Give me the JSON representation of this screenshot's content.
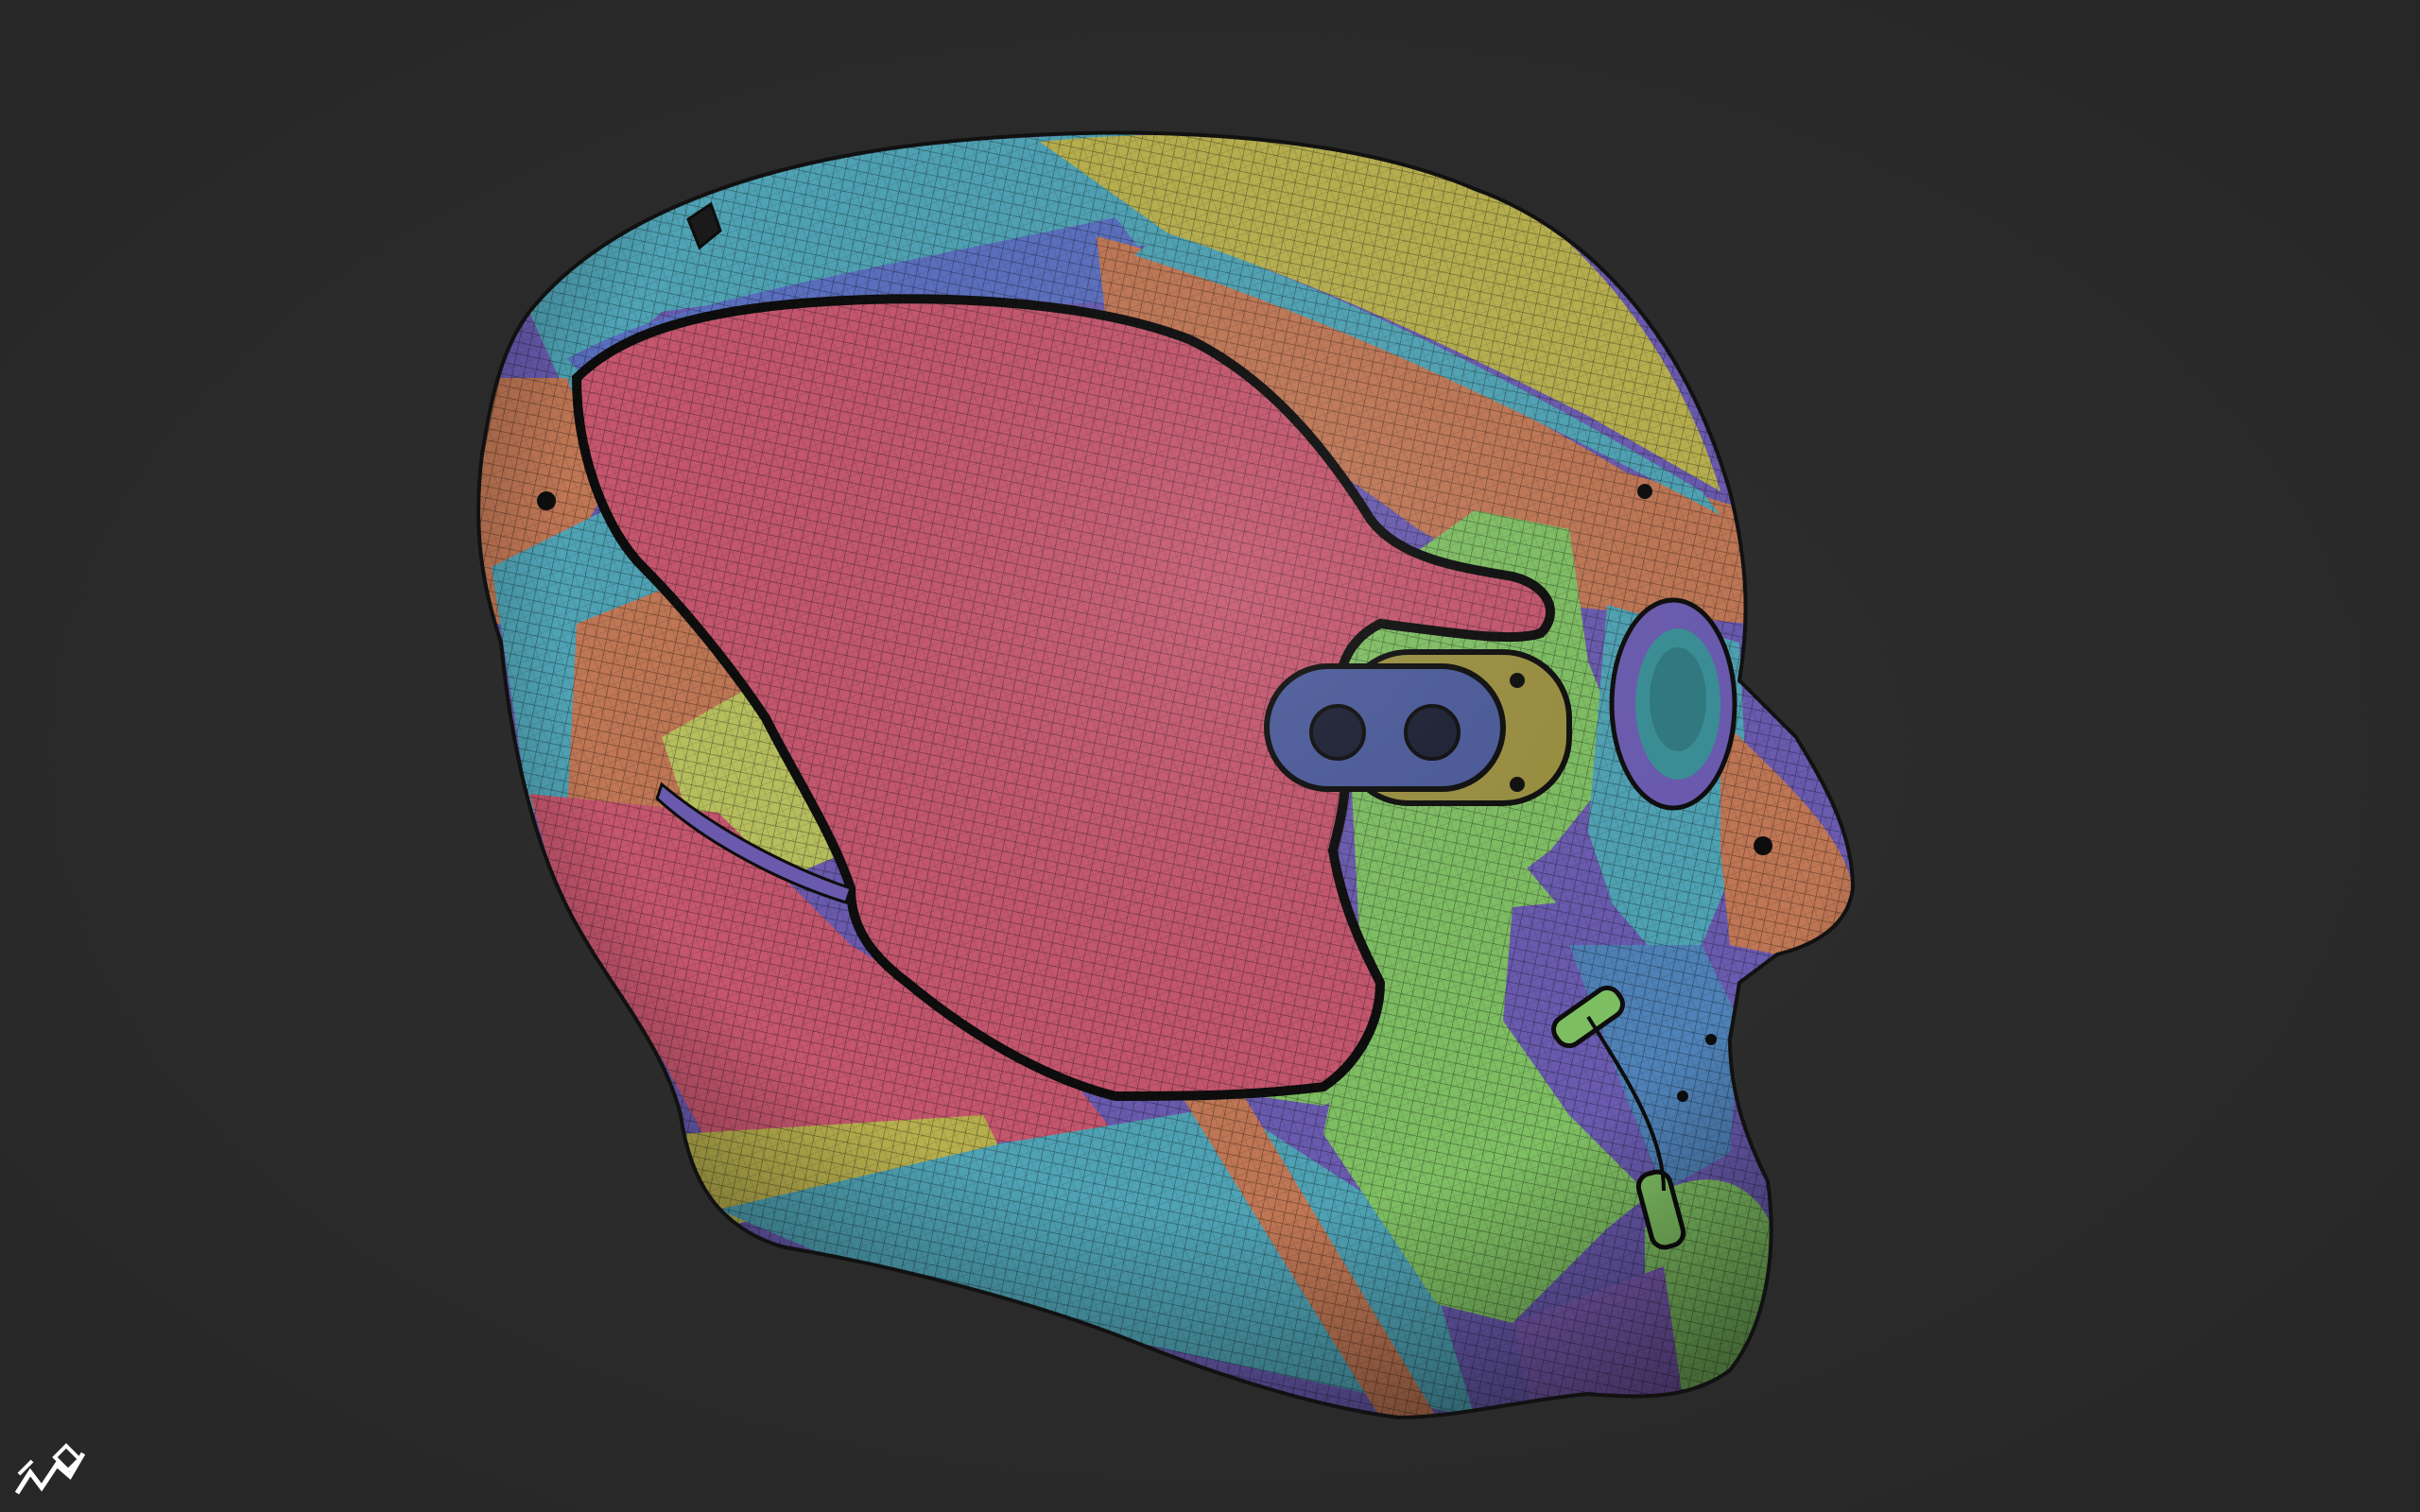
{
  "viewport": {
    "background": "#2a2a2a",
    "description_icon": "3d-viewport"
  },
  "model": {
    "icon": "polygroup-head-mesh",
    "colors": {
      "pink": "#c5566e",
      "teal": "#4fa3b5",
      "green": "#7fc063",
      "yellow": "#b8b04e",
      "orange": "#c07755",
      "purple": "#6a5bb0",
      "blue": "#5a6fc0",
      "outline": "#0d0d0d"
    }
  },
  "logo": {
    "icon": "zbrush-logo-icon",
    "color": "#ffffff"
  }
}
